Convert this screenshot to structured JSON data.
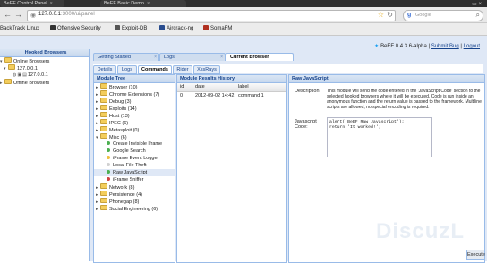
{
  "browser": {
    "tabs": [
      {
        "label": "BeEF Control Panel",
        "close": "×"
      },
      {
        "label": "BeEF Basic Demo",
        "close": "×"
      }
    ],
    "window_controls": "– ▭ ×",
    "back_icon": "←",
    "forward_icon": "→",
    "home_icon": "S",
    "url_host": "127.0.0.1",
    "url_path": ":3000/ui/panel",
    "search_placeholder": "Google",
    "bookmarks": [
      {
        "label": "BackTrack Linux",
        "color": "#222222"
      },
      {
        "label": "Offensive Security",
        "color": "#333333"
      },
      {
        "label": "Exploit-DB",
        "color": "#555555"
      },
      {
        "label": "Aircrack-ng",
        "color": "#2a4d8f"
      },
      {
        "label": "SomaFM",
        "color": "#b03020"
      }
    ]
  },
  "sidebar": {
    "title": "Hooked Browsers",
    "online_label": "Online Browsers",
    "ip_label": "127.0.0.1",
    "hook_ip": "127.0.0.1",
    "offline_label": "Offline Browsers"
  },
  "top_info": {
    "version": "BeEF 0.4.3.6-alpha",
    "separator1": "|",
    "submit_bug": "Submit Bug",
    "separator2": "|",
    "logout": "Logout"
  },
  "main_tabs": [
    {
      "label": "Getting Started",
      "close": "×"
    },
    {
      "label": "Logs",
      "close": "×"
    },
    {
      "label": "Current Browser",
      "close": ""
    }
  ],
  "sub_tabs": [
    "Details",
    "Logs",
    "Commands",
    "Rider",
    "XssRays"
  ],
  "module_tree": {
    "title": "Module Tree",
    "categories": [
      {
        "label": "Browser (10)",
        "expanded": false
      },
      {
        "label": "Chrome Extensions (7)",
        "expanded": false
      },
      {
        "label": "Debug (3)",
        "expanded": false
      },
      {
        "label": "Exploits (14)",
        "expanded": false
      },
      {
        "label": "Host (13)",
        "expanded": false
      },
      {
        "label": "IPEC (6)",
        "expanded": false
      },
      {
        "label": "Metasploit (0)",
        "expanded": false
      },
      {
        "label": "Misc (6)",
        "expanded": true
      }
    ],
    "misc_children": [
      {
        "label": "Create Invisible Iframe",
        "color": "#4caf50"
      },
      {
        "label": "Google Search",
        "color": "#4caf50"
      },
      {
        "label": "iFrame Event Logger",
        "color": "#f0c040"
      },
      {
        "label": "Local File Theft",
        "color": "#d0d0d0"
      },
      {
        "label": "Raw JavaScript",
        "color": "#4caf50"
      },
      {
        "label": "iFrame Sniffer",
        "color": "#d04040"
      }
    ],
    "after_categories": [
      {
        "label": "Network (8)"
      },
      {
        "label": "Persistence (4)"
      },
      {
        "label": "Phonegap (8)"
      },
      {
        "label": "Social Engineering (6)"
      }
    ]
  },
  "results": {
    "title": "Module Results History",
    "columns": [
      "id",
      "date",
      "label"
    ],
    "rows": [
      {
        "id": "0",
        "date": "2012-09-02 14:42",
        "label": "command 1"
      }
    ]
  },
  "raw_js": {
    "title": "Raw JavaScript",
    "description_label": "Description:",
    "description": "This module will send the code entered in the 'JavaScript Code' section to the selected hooked browsers where it will be executed. Code is run inside an anonymous function and the return value is passed to the framework. Multiline scripts are allowed, no special encoding is required.",
    "code_label": "Javascript Code:",
    "code_line1": "alert('BeEF Raw Javascript');",
    "code_line2": "return 'It worked!';",
    "execute_label": "Execute"
  },
  "watermark": "DiscuzL"
}
